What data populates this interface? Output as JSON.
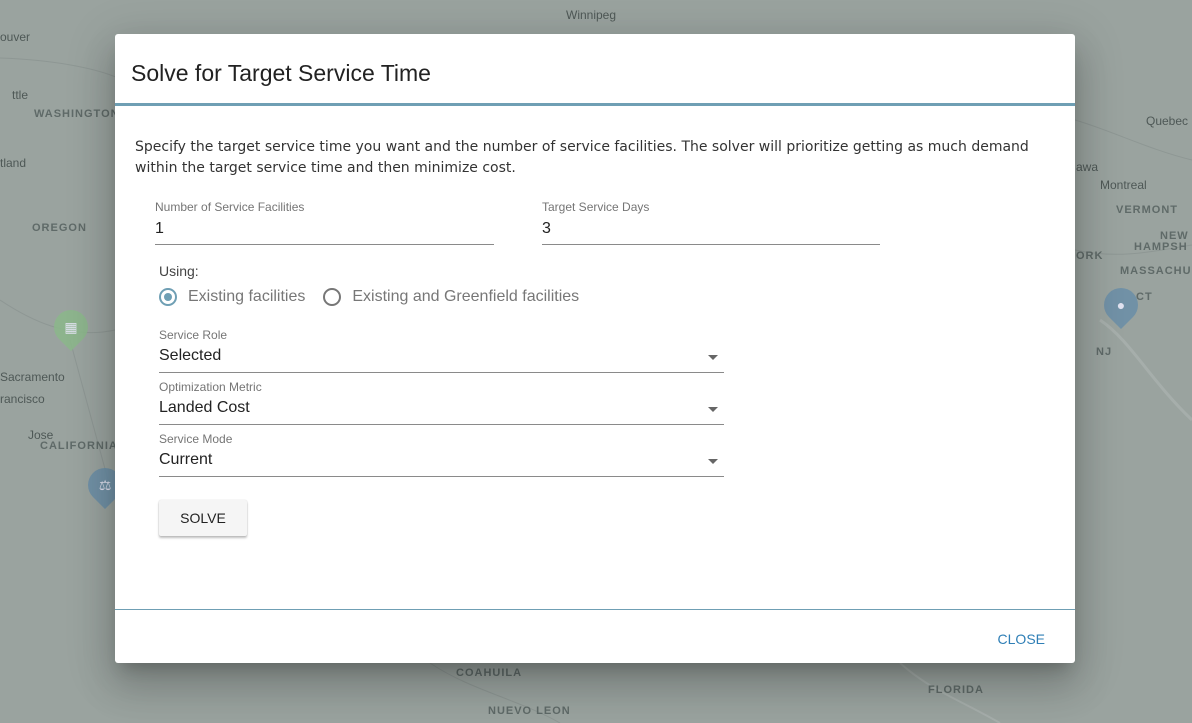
{
  "map": {
    "labels": [
      "Winnipeg",
      "ouver",
      "ttle",
      "WASHINGTON",
      "tland",
      "OREGON",
      "Sacramento",
      "rancisco",
      "Jose",
      "CALIFORNIA",
      "Quebec",
      "awa",
      "Montreal",
      "VERMONT",
      "NEW",
      "HAMPSH",
      "ORK",
      "MASSACHU",
      "CT",
      "NJ",
      "COAHUILA",
      "NUEVO LEON",
      "FLORIDA"
    ]
  },
  "dialog": {
    "title": "Solve for Target Service Time",
    "description": "Specify the target service time you want and the number of service facilities. The solver will prioritize getting as much demand within the target service time and then minimize cost.",
    "num_facilities": {
      "label": "Number of Service Facilities",
      "value": "1"
    },
    "target_days": {
      "label": "Target Service Days",
      "value": "3"
    },
    "using_label": "Using:",
    "radio_options": [
      {
        "label": "Existing facilities",
        "checked": true
      },
      {
        "label": "Existing and Greenfield facilities",
        "checked": false
      }
    ],
    "service_role": {
      "label": "Service Role",
      "value": "Selected"
    },
    "optimization_metric": {
      "label": "Optimization Metric",
      "value": "Landed Cost"
    },
    "service_mode": {
      "label": "Service Mode",
      "value": "Current"
    },
    "solve_label": "SOLVE",
    "close_label": "CLOSE"
  },
  "colors": {
    "accent": "#6f9fb4",
    "link": "#2f7fb6",
    "overlay": "#9aa39f"
  }
}
